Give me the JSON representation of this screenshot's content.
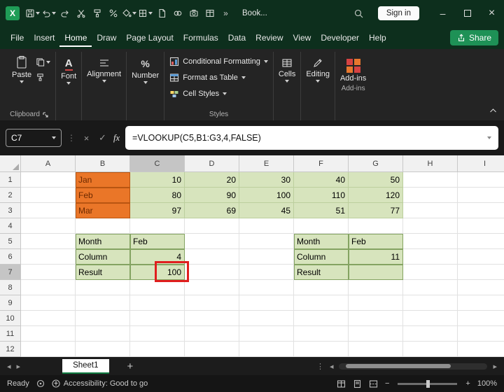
{
  "colors": {
    "titlebar": "#0D2F1D",
    "ribbon": "#242424",
    "accent_green": "#107C41",
    "share_green": "#1E9156",
    "orange_fill": "#EA7628",
    "orange_border": "#B85511",
    "orange_text": "#6E2A00",
    "green_fill": "#D7E4BD",
    "green_border": "#BCCF9E",
    "table_border": "#84A362",
    "annotation_red": "#E01E1E",
    "selected_header": "#C5C5C5"
  },
  "titlebar": {
    "workbook_name": "Book...",
    "signin_label": "Sign in",
    "qat_icons": [
      "excel-logo",
      "save",
      "undo",
      "redo",
      "cut",
      "format-painter",
      "number-format",
      "paint-bucket",
      "borders",
      "new-document",
      "link",
      "camera",
      "table",
      "overflow",
      "search"
    ]
  },
  "menu": {
    "items": [
      "File",
      "Insert",
      "Home",
      "Draw",
      "Page Layout",
      "Formulas",
      "Data",
      "Review",
      "View",
      "Developer",
      "Help"
    ],
    "active_item": "Home",
    "share_label": "Share"
  },
  "ribbon": {
    "paste": "Paste",
    "collapsed": {
      "font": "Font",
      "alignment": "Alignment",
      "number": "Number",
      "cells": "Cells",
      "editing": "Editing",
      "addins": "Add-ins"
    },
    "styles_buttons": [
      "Conditional Formatting",
      "Format as Table",
      "Cell Styles"
    ],
    "group_labels": {
      "clipboard": "Clipboard",
      "styles": "Styles",
      "addins": "Add-ins"
    }
  },
  "formula_bar": {
    "name_box": "C7",
    "fx_label": "fx",
    "formula": "=VLOOKUP(C5,B1:G3,4,FALSE)"
  },
  "grid": {
    "col_headers": [
      "A",
      "B",
      "C",
      "D",
      "E",
      "F",
      "G",
      "H",
      "I"
    ],
    "row_headers": [
      "1",
      "2",
      "3",
      "4",
      "5",
      "6",
      "7",
      "8",
      "9",
      "10",
      "11",
      "12"
    ],
    "selected_col": "C",
    "selected_row": "7",
    "annotated_cell": "C7",
    "cells": [
      {
        "col": "B",
        "row": 1,
        "value": "Jan",
        "style": "orange",
        "align": "left"
      },
      {
        "col": "C",
        "row": 1,
        "value": "10",
        "style": "green",
        "align": "right"
      },
      {
        "col": "D",
        "row": 1,
        "value": "20",
        "style": "green",
        "align": "right"
      },
      {
        "col": "E",
        "row": 1,
        "value": "30",
        "style": "green",
        "align": "right"
      },
      {
        "col": "F",
        "row": 1,
        "value": "40",
        "style": "green",
        "align": "right"
      },
      {
        "col": "G",
        "row": 1,
        "value": "50",
        "style": "green",
        "align": "right"
      },
      {
        "col": "B",
        "row": 2,
        "value": "Feb",
        "style": "orange",
        "align": "left"
      },
      {
        "col": "C",
        "row": 2,
        "value": "80",
        "style": "green",
        "align": "right"
      },
      {
        "col": "D",
        "row": 2,
        "value": "90",
        "style": "green",
        "align": "right"
      },
      {
        "col": "E",
        "row": 2,
        "value": "100",
        "style": "green",
        "align": "right"
      },
      {
        "col": "F",
        "row": 2,
        "value": "110",
        "style": "green",
        "align": "right"
      },
      {
        "col": "G",
        "row": 2,
        "value": "120",
        "style": "green",
        "align": "right"
      },
      {
        "col": "B",
        "row": 3,
        "value": "Mar",
        "style": "orange",
        "align": "left"
      },
      {
        "col": "C",
        "row": 3,
        "value": "97",
        "style": "green",
        "align": "right"
      },
      {
        "col": "D",
        "row": 3,
        "value": "69",
        "style": "green",
        "align": "right"
      },
      {
        "col": "E",
        "row": 3,
        "value": "45",
        "style": "green",
        "align": "right"
      },
      {
        "col": "F",
        "row": 3,
        "value": "51",
        "style": "green",
        "align": "right"
      },
      {
        "col": "G",
        "row": 3,
        "value": "77",
        "style": "green",
        "align": "right"
      },
      {
        "col": "B",
        "row": 5,
        "value": "Month",
        "style": "table",
        "align": "left"
      },
      {
        "col": "C",
        "row": 5,
        "value": "Feb",
        "style": "table",
        "align": "left"
      },
      {
        "col": "F",
        "row": 5,
        "value": "Month",
        "style": "table",
        "align": "left"
      },
      {
        "col": "G",
        "row": 5,
        "value": "Feb",
        "style": "table",
        "align": "left"
      },
      {
        "col": "B",
        "row": 6,
        "value": "Column",
        "style": "table",
        "align": "left"
      },
      {
        "col": "C",
        "row": 6,
        "value": "4",
        "style": "table",
        "align": "right"
      },
      {
        "col": "F",
        "row": 6,
        "value": "Column",
        "style": "table",
        "align": "left"
      },
      {
        "col": "G",
        "row": 6,
        "value": "11",
        "style": "table",
        "align": "right"
      },
      {
        "col": "B",
        "row": 7,
        "value": "Result",
        "style": "table",
        "align": "left"
      },
      {
        "col": "C",
        "row": 7,
        "value": "100",
        "style": "table",
        "align": "right"
      },
      {
        "col": "F",
        "row": 7,
        "value": "Result",
        "style": "table",
        "align": "left"
      },
      {
        "col": "G",
        "row": 7,
        "value": "",
        "style": "table",
        "align": "right"
      }
    ]
  },
  "sheet_tabs": {
    "tabs": [
      "Sheet1"
    ],
    "active": "Sheet1"
  },
  "status_bar": {
    "mode": "Ready",
    "accessibility": "Accessibility: Good to go",
    "zoom": "100%"
  }
}
